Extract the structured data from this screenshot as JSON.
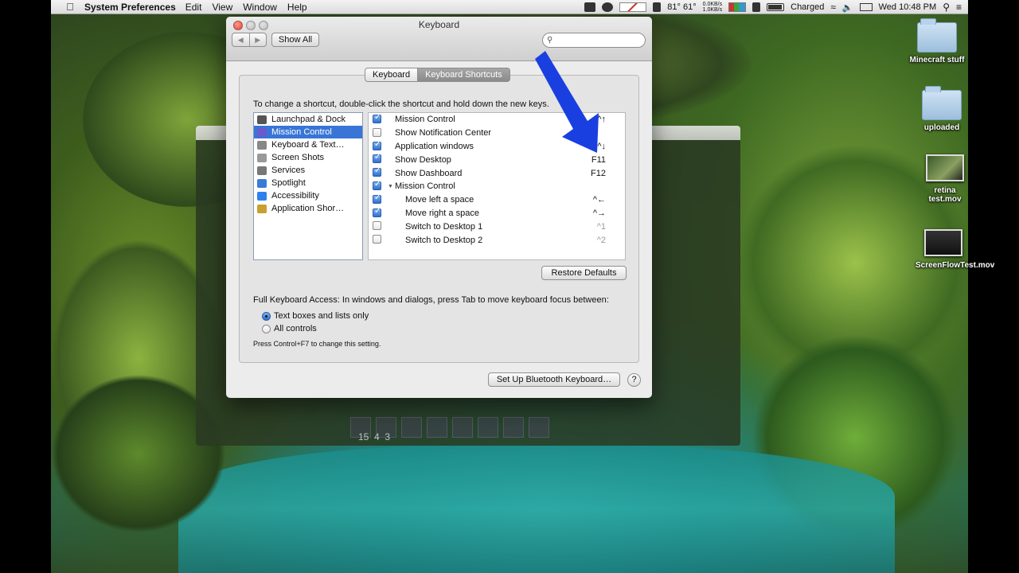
{
  "menubar": {
    "app_name": "System Preferences",
    "menus": [
      "Edit",
      "View",
      "Window",
      "Help"
    ],
    "temps": "81° 61°",
    "net_up": "0.0KB/s",
    "net_down": "1.0KB/s",
    "battery_status": "Charged",
    "clock": "Wed 10:48 PM"
  },
  "window": {
    "title": "Keyboard",
    "show_all_label": "Show All",
    "search_placeholder": "",
    "tabs": [
      "Keyboard",
      "Keyboard Shortcuts"
    ],
    "selected_tab": "Keyboard Shortcuts",
    "instruction": "To change a shortcut, double-click the shortcut and hold down the new keys.",
    "categories": [
      {
        "label": "Launchpad & Dock",
        "icon": "launchpad-icon"
      },
      {
        "label": "Mission Control",
        "icon": "mission-control-icon"
      },
      {
        "label": "Keyboard & Text…",
        "icon": "keyboard-icon"
      },
      {
        "label": "Screen Shots",
        "icon": "screenshot-icon"
      },
      {
        "label": "Services",
        "icon": "gear-icon"
      },
      {
        "label": "Spotlight",
        "icon": "spotlight-icon"
      },
      {
        "label": "Accessibility",
        "icon": "accessibility-icon"
      },
      {
        "label": "Application Shor…",
        "icon": "app-shortcuts-icon"
      }
    ],
    "selected_category": "Mission Control",
    "shortcuts": [
      {
        "label": "Mission Control",
        "key": "^↑",
        "checked": true,
        "indent": false,
        "group": false
      },
      {
        "label": "Show Notification Center",
        "key": "",
        "checked": false,
        "indent": false,
        "group": false
      },
      {
        "label": "Application windows",
        "key": "^↓",
        "checked": true,
        "indent": false,
        "group": false
      },
      {
        "label": "Show Desktop",
        "key": "F11",
        "checked": true,
        "indent": false,
        "group": false
      },
      {
        "label": "Show Dashboard",
        "key": "F12",
        "checked": true,
        "indent": false,
        "group": false
      },
      {
        "label": "Mission Control",
        "key": "",
        "checked": true,
        "indent": false,
        "group": true
      },
      {
        "label": "Move left a space",
        "key": "^←",
        "checked": true,
        "indent": true,
        "group": false
      },
      {
        "label": "Move right a space",
        "key": "^→",
        "checked": true,
        "indent": true,
        "group": false
      },
      {
        "label": "Switch to Desktop 1",
        "key": "^1",
        "checked": false,
        "indent": true,
        "group": false
      },
      {
        "label": "Switch to Desktop 2",
        "key": "^2",
        "checked": false,
        "indent": true,
        "group": false
      }
    ],
    "restore_defaults_label": "Restore Defaults",
    "full_keyboard_access_label": "Full Keyboard Access: In windows and dialogs, press Tab to move keyboard focus between:",
    "radio_options": [
      "Text boxes and lists only",
      "All controls"
    ],
    "radio_selected": 0,
    "hint": "Press Control+F7 to change this setting.",
    "bluetooth_button_label": "Set Up Bluetooth Keyboard…",
    "help_label": "?"
  },
  "background_window": {
    "hotbar_text": "15  4  3"
  },
  "desktop_icons": [
    {
      "label": "Minecraft stuff",
      "kind": "folder"
    },
    {
      "label": "uploaded",
      "kind": "folder"
    },
    {
      "label": "retina test.mov",
      "kind": "movie"
    },
    {
      "label": "ScreenFlowTest.mov",
      "kind": "movie"
    }
  ],
  "colors": {
    "selection_blue": "#3875d7",
    "annotation_arrow": "#1a3fe0"
  }
}
